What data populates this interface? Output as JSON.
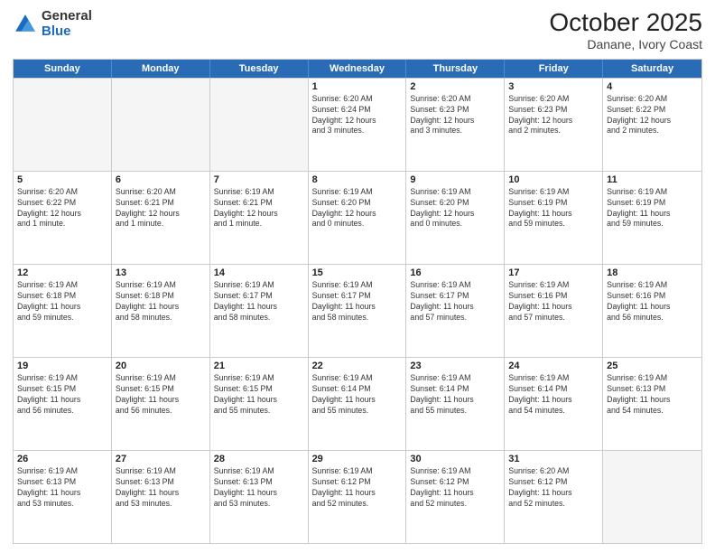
{
  "header": {
    "logo_general": "General",
    "logo_blue": "Blue",
    "month_title": "October 2025",
    "location": "Danane, Ivory Coast"
  },
  "days_of_week": [
    "Sunday",
    "Monday",
    "Tuesday",
    "Wednesday",
    "Thursday",
    "Friday",
    "Saturday"
  ],
  "weeks": [
    [
      {
        "day": "",
        "empty": true
      },
      {
        "day": "",
        "empty": true
      },
      {
        "day": "",
        "empty": true
      },
      {
        "day": "1",
        "line1": "Sunrise: 6:20 AM",
        "line2": "Sunset: 6:24 PM",
        "line3": "Daylight: 12 hours",
        "line4": "and 3 minutes."
      },
      {
        "day": "2",
        "line1": "Sunrise: 6:20 AM",
        "line2": "Sunset: 6:23 PM",
        "line3": "Daylight: 12 hours",
        "line4": "and 3 minutes."
      },
      {
        "day": "3",
        "line1": "Sunrise: 6:20 AM",
        "line2": "Sunset: 6:23 PM",
        "line3": "Daylight: 12 hours",
        "line4": "and 2 minutes."
      },
      {
        "day": "4",
        "line1": "Sunrise: 6:20 AM",
        "line2": "Sunset: 6:22 PM",
        "line3": "Daylight: 12 hours",
        "line4": "and 2 minutes."
      }
    ],
    [
      {
        "day": "5",
        "line1": "Sunrise: 6:20 AM",
        "line2": "Sunset: 6:22 PM",
        "line3": "Daylight: 12 hours",
        "line4": "and 1 minute."
      },
      {
        "day": "6",
        "line1": "Sunrise: 6:20 AM",
        "line2": "Sunset: 6:21 PM",
        "line3": "Daylight: 12 hours",
        "line4": "and 1 minute."
      },
      {
        "day": "7",
        "line1": "Sunrise: 6:19 AM",
        "line2": "Sunset: 6:21 PM",
        "line3": "Daylight: 12 hours",
        "line4": "and 1 minute."
      },
      {
        "day": "8",
        "line1": "Sunrise: 6:19 AM",
        "line2": "Sunset: 6:20 PM",
        "line3": "Daylight: 12 hours",
        "line4": "and 0 minutes."
      },
      {
        "day": "9",
        "line1": "Sunrise: 6:19 AM",
        "line2": "Sunset: 6:20 PM",
        "line3": "Daylight: 12 hours",
        "line4": "and 0 minutes."
      },
      {
        "day": "10",
        "line1": "Sunrise: 6:19 AM",
        "line2": "Sunset: 6:19 PM",
        "line3": "Daylight: 11 hours",
        "line4": "and 59 minutes."
      },
      {
        "day": "11",
        "line1": "Sunrise: 6:19 AM",
        "line2": "Sunset: 6:19 PM",
        "line3": "Daylight: 11 hours",
        "line4": "and 59 minutes."
      }
    ],
    [
      {
        "day": "12",
        "line1": "Sunrise: 6:19 AM",
        "line2": "Sunset: 6:18 PM",
        "line3": "Daylight: 11 hours",
        "line4": "and 59 minutes."
      },
      {
        "day": "13",
        "line1": "Sunrise: 6:19 AM",
        "line2": "Sunset: 6:18 PM",
        "line3": "Daylight: 11 hours",
        "line4": "and 58 minutes."
      },
      {
        "day": "14",
        "line1": "Sunrise: 6:19 AM",
        "line2": "Sunset: 6:17 PM",
        "line3": "Daylight: 11 hours",
        "line4": "and 58 minutes."
      },
      {
        "day": "15",
        "line1": "Sunrise: 6:19 AM",
        "line2": "Sunset: 6:17 PM",
        "line3": "Daylight: 11 hours",
        "line4": "and 58 minutes."
      },
      {
        "day": "16",
        "line1": "Sunrise: 6:19 AM",
        "line2": "Sunset: 6:17 PM",
        "line3": "Daylight: 11 hours",
        "line4": "and 57 minutes."
      },
      {
        "day": "17",
        "line1": "Sunrise: 6:19 AM",
        "line2": "Sunset: 6:16 PM",
        "line3": "Daylight: 11 hours",
        "line4": "and 57 minutes."
      },
      {
        "day": "18",
        "line1": "Sunrise: 6:19 AM",
        "line2": "Sunset: 6:16 PM",
        "line3": "Daylight: 11 hours",
        "line4": "and 56 minutes."
      }
    ],
    [
      {
        "day": "19",
        "line1": "Sunrise: 6:19 AM",
        "line2": "Sunset: 6:15 PM",
        "line3": "Daylight: 11 hours",
        "line4": "and 56 minutes."
      },
      {
        "day": "20",
        "line1": "Sunrise: 6:19 AM",
        "line2": "Sunset: 6:15 PM",
        "line3": "Daylight: 11 hours",
        "line4": "and 56 minutes."
      },
      {
        "day": "21",
        "line1": "Sunrise: 6:19 AM",
        "line2": "Sunset: 6:15 PM",
        "line3": "Daylight: 11 hours",
        "line4": "and 55 minutes."
      },
      {
        "day": "22",
        "line1": "Sunrise: 6:19 AM",
        "line2": "Sunset: 6:14 PM",
        "line3": "Daylight: 11 hours",
        "line4": "and 55 minutes."
      },
      {
        "day": "23",
        "line1": "Sunrise: 6:19 AM",
        "line2": "Sunset: 6:14 PM",
        "line3": "Daylight: 11 hours",
        "line4": "and 55 minutes."
      },
      {
        "day": "24",
        "line1": "Sunrise: 6:19 AM",
        "line2": "Sunset: 6:14 PM",
        "line3": "Daylight: 11 hours",
        "line4": "and 54 minutes."
      },
      {
        "day": "25",
        "line1": "Sunrise: 6:19 AM",
        "line2": "Sunset: 6:13 PM",
        "line3": "Daylight: 11 hours",
        "line4": "and 54 minutes."
      }
    ],
    [
      {
        "day": "26",
        "line1": "Sunrise: 6:19 AM",
        "line2": "Sunset: 6:13 PM",
        "line3": "Daylight: 11 hours",
        "line4": "and 53 minutes."
      },
      {
        "day": "27",
        "line1": "Sunrise: 6:19 AM",
        "line2": "Sunset: 6:13 PM",
        "line3": "Daylight: 11 hours",
        "line4": "and 53 minutes."
      },
      {
        "day": "28",
        "line1": "Sunrise: 6:19 AM",
        "line2": "Sunset: 6:13 PM",
        "line3": "Daylight: 11 hours",
        "line4": "and 53 minutes."
      },
      {
        "day": "29",
        "line1": "Sunrise: 6:19 AM",
        "line2": "Sunset: 6:12 PM",
        "line3": "Daylight: 11 hours",
        "line4": "and 52 minutes."
      },
      {
        "day": "30",
        "line1": "Sunrise: 6:19 AM",
        "line2": "Sunset: 6:12 PM",
        "line3": "Daylight: 11 hours",
        "line4": "and 52 minutes."
      },
      {
        "day": "31",
        "line1": "Sunrise: 6:20 AM",
        "line2": "Sunset: 6:12 PM",
        "line3": "Daylight: 11 hours",
        "line4": "and 52 minutes."
      },
      {
        "day": "",
        "empty": true
      }
    ]
  ]
}
